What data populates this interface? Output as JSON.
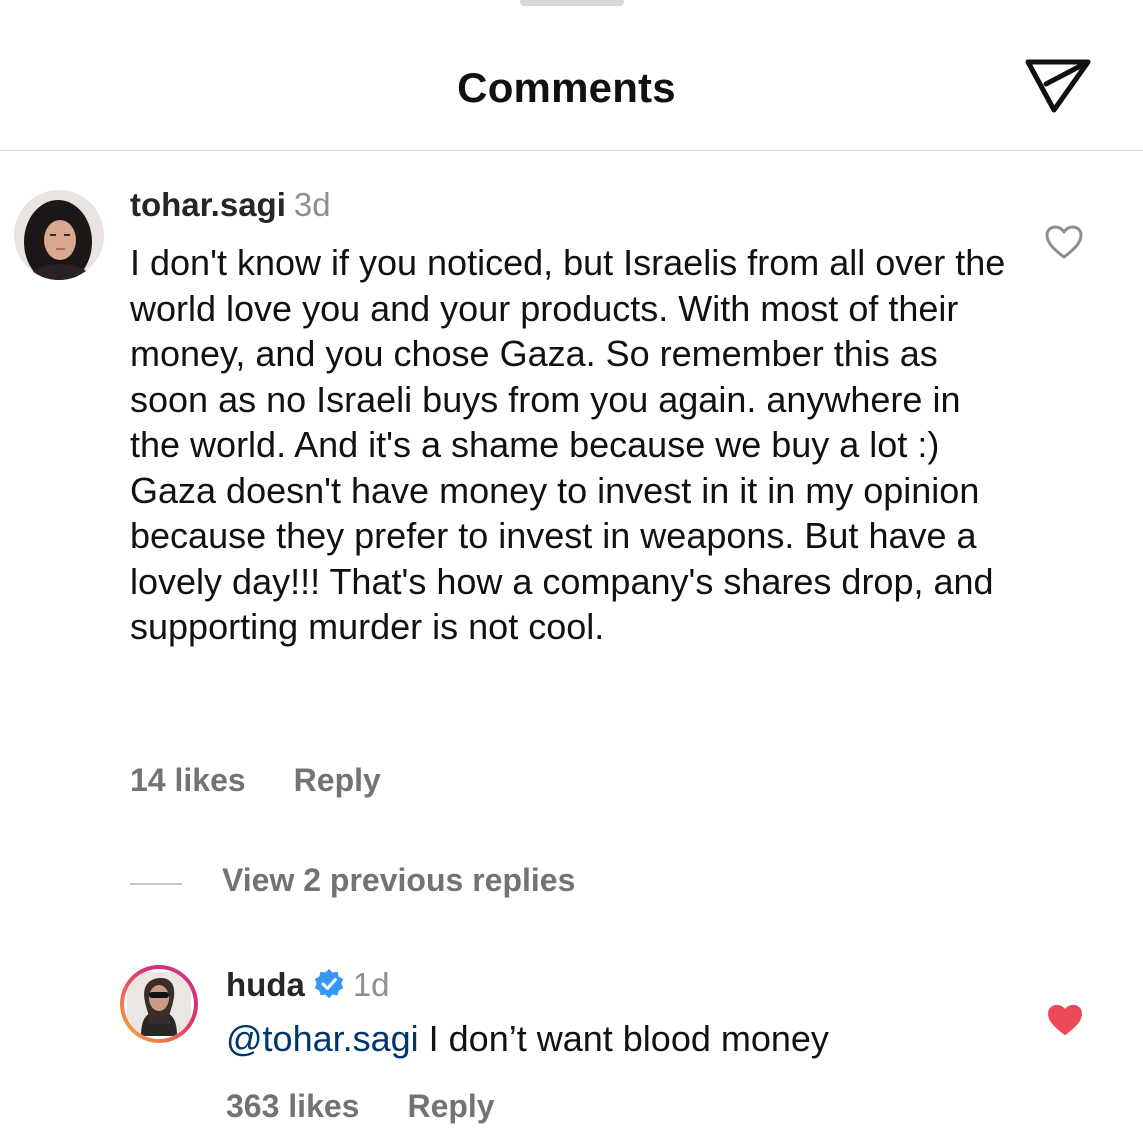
{
  "header": {
    "title": "Comments",
    "share_icon": "send-icon"
  },
  "comments": [
    {
      "username": "tohar.sagi",
      "time": "3d",
      "text": "I don't know if you noticed, but Israelis from all over the world love you and your products. With most of their money, and you chose Gaza. So remember this as soon as no Israeli buys from you again. anywhere in the world. And it's a shame because we buy a lot :) Gaza doesn't have money to invest in it in my opinion because they prefer to invest in weapons. But have a lovely day!!! That's how a company's shares drop, and supporting murder is not cool.",
      "likes": "14 likes",
      "reply_label": "Reply",
      "liked": false,
      "heart_icon": "heart-outline-icon"
    }
  ],
  "view_replies": "View 2 previous replies",
  "reply": {
    "username": "huda",
    "verified": true,
    "time": "1d",
    "mention": "@tohar.sagi",
    "text": " I don’t want blood money",
    "likes": "363 likes",
    "reply_label": "Reply",
    "liked": true,
    "heart_icon": "heart-filled-icon",
    "heart_color": "#ed4956"
  },
  "colors": {
    "secondary_text": "#737373",
    "timestamp": "#8e8e8e",
    "mention": "#00376b",
    "verified_badge": "#3897f0",
    "divider": "#dbdbdb"
  }
}
